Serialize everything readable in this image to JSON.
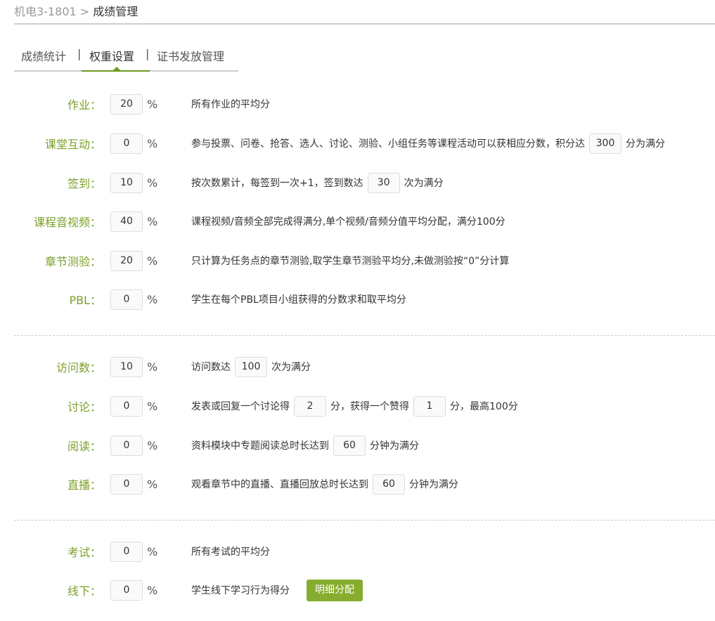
{
  "breadcrumb": {
    "course": "机电3-1801",
    "separator": ">",
    "current": "成绩管理"
  },
  "tabs": [
    {
      "label": "成绩统计"
    },
    {
      "label": "权重设置"
    },
    {
      "label": "证书发放管理"
    }
  ],
  "tab_separator": "|",
  "percent": "%",
  "rows": [
    {
      "label": "作业：",
      "value": "20",
      "d1": "所有作业的平均分"
    },
    {
      "label": "课堂互动：",
      "value": "0",
      "d1": "参与投票、问卷、抢答、选人、讨论、测验、小组任务等课程活动可以获相应分数，积分达",
      "v1": "300",
      "d2": "分为满分"
    },
    {
      "label": "签到：",
      "value": "10",
      "d1": "按次数累计，每签到一次+1，签到数达",
      "v1": "30",
      "d2": "次为满分"
    },
    {
      "label": "课程音视频：",
      "value": "40",
      "d1": "课程视频/音频全部完成得满分,单个视频/音频分值平均分配，满分100分"
    },
    {
      "label": "章节测验：",
      "value": "20",
      "d1": "只计算为任务点的章节测验,取学生章节测验平均分,未做测验按“0”分计算"
    },
    {
      "label": "PBL：",
      "value": "0",
      "d1": "学生在每个PBL项目小组获得的分数求和取平均分"
    },
    {
      "label": "访问数：",
      "value": "10",
      "d1": "访问数达",
      "v1": "100",
      "d2": "次为满分"
    },
    {
      "label": "讨论：",
      "value": "0",
      "d1": "发表或回复一个讨论得",
      "v1": "2",
      "d2": "分，获得一个赞得",
      "v2": "1",
      "d3": "分，最高100分"
    },
    {
      "label": "阅读：",
      "value": "0",
      "d1": "资料模块中专题阅读总时长达到",
      "v1": "60",
      "d2": "分钟为满分"
    },
    {
      "label": "直播：",
      "value": "0",
      "d1": "观看章节中的直播、直播回放总时长达到",
      "v1": "60",
      "d2": "分钟为满分"
    },
    {
      "label": "考试：",
      "value": "0",
      "d1": "所有考试的平均分"
    },
    {
      "label": "线下：",
      "value": "0",
      "d1": "学生线下学习行为得分",
      "button": "明细分配"
    }
  ]
}
